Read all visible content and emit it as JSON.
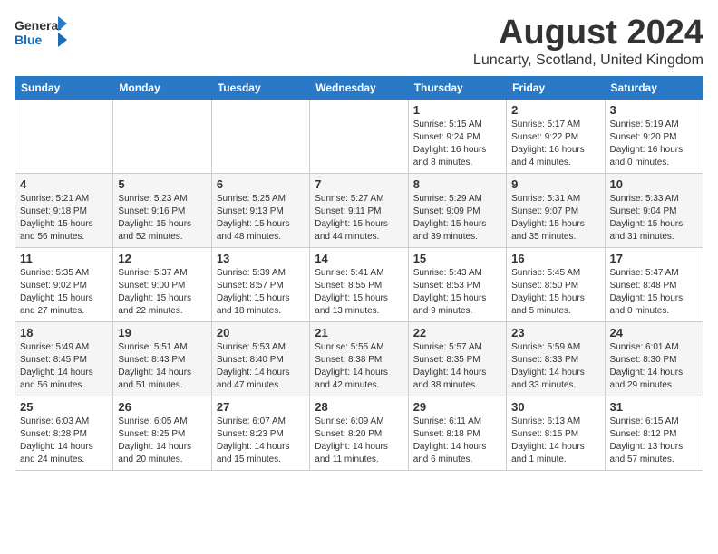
{
  "logo": {
    "general": "General",
    "blue": "Blue"
  },
  "header": {
    "title": "August 2024",
    "subtitle": "Luncarty, Scotland, United Kingdom"
  },
  "weekdays": [
    "Sunday",
    "Monday",
    "Tuesday",
    "Wednesday",
    "Thursday",
    "Friday",
    "Saturday"
  ],
  "weeks": [
    [
      {
        "day": "",
        "info": ""
      },
      {
        "day": "",
        "info": ""
      },
      {
        "day": "",
        "info": ""
      },
      {
        "day": "",
        "info": ""
      },
      {
        "day": "1",
        "info": "Sunrise: 5:15 AM\nSunset: 9:24 PM\nDaylight: 16 hours\nand 8 minutes."
      },
      {
        "day": "2",
        "info": "Sunrise: 5:17 AM\nSunset: 9:22 PM\nDaylight: 16 hours\nand 4 minutes."
      },
      {
        "day": "3",
        "info": "Sunrise: 5:19 AM\nSunset: 9:20 PM\nDaylight: 16 hours\nand 0 minutes."
      }
    ],
    [
      {
        "day": "4",
        "info": "Sunrise: 5:21 AM\nSunset: 9:18 PM\nDaylight: 15 hours\nand 56 minutes."
      },
      {
        "day": "5",
        "info": "Sunrise: 5:23 AM\nSunset: 9:16 PM\nDaylight: 15 hours\nand 52 minutes."
      },
      {
        "day": "6",
        "info": "Sunrise: 5:25 AM\nSunset: 9:13 PM\nDaylight: 15 hours\nand 48 minutes."
      },
      {
        "day": "7",
        "info": "Sunrise: 5:27 AM\nSunset: 9:11 PM\nDaylight: 15 hours\nand 44 minutes."
      },
      {
        "day": "8",
        "info": "Sunrise: 5:29 AM\nSunset: 9:09 PM\nDaylight: 15 hours\nand 39 minutes."
      },
      {
        "day": "9",
        "info": "Sunrise: 5:31 AM\nSunset: 9:07 PM\nDaylight: 15 hours\nand 35 minutes."
      },
      {
        "day": "10",
        "info": "Sunrise: 5:33 AM\nSunset: 9:04 PM\nDaylight: 15 hours\nand 31 minutes."
      }
    ],
    [
      {
        "day": "11",
        "info": "Sunrise: 5:35 AM\nSunset: 9:02 PM\nDaylight: 15 hours\nand 27 minutes."
      },
      {
        "day": "12",
        "info": "Sunrise: 5:37 AM\nSunset: 9:00 PM\nDaylight: 15 hours\nand 22 minutes."
      },
      {
        "day": "13",
        "info": "Sunrise: 5:39 AM\nSunset: 8:57 PM\nDaylight: 15 hours\nand 18 minutes."
      },
      {
        "day": "14",
        "info": "Sunrise: 5:41 AM\nSunset: 8:55 PM\nDaylight: 15 hours\nand 13 minutes."
      },
      {
        "day": "15",
        "info": "Sunrise: 5:43 AM\nSunset: 8:53 PM\nDaylight: 15 hours\nand 9 minutes."
      },
      {
        "day": "16",
        "info": "Sunrise: 5:45 AM\nSunset: 8:50 PM\nDaylight: 15 hours\nand 5 minutes."
      },
      {
        "day": "17",
        "info": "Sunrise: 5:47 AM\nSunset: 8:48 PM\nDaylight: 15 hours\nand 0 minutes."
      }
    ],
    [
      {
        "day": "18",
        "info": "Sunrise: 5:49 AM\nSunset: 8:45 PM\nDaylight: 14 hours\nand 56 minutes."
      },
      {
        "day": "19",
        "info": "Sunrise: 5:51 AM\nSunset: 8:43 PM\nDaylight: 14 hours\nand 51 minutes."
      },
      {
        "day": "20",
        "info": "Sunrise: 5:53 AM\nSunset: 8:40 PM\nDaylight: 14 hours\nand 47 minutes."
      },
      {
        "day": "21",
        "info": "Sunrise: 5:55 AM\nSunset: 8:38 PM\nDaylight: 14 hours\nand 42 minutes."
      },
      {
        "day": "22",
        "info": "Sunrise: 5:57 AM\nSunset: 8:35 PM\nDaylight: 14 hours\nand 38 minutes."
      },
      {
        "day": "23",
        "info": "Sunrise: 5:59 AM\nSunset: 8:33 PM\nDaylight: 14 hours\nand 33 minutes."
      },
      {
        "day": "24",
        "info": "Sunrise: 6:01 AM\nSunset: 8:30 PM\nDaylight: 14 hours\nand 29 minutes."
      }
    ],
    [
      {
        "day": "25",
        "info": "Sunrise: 6:03 AM\nSunset: 8:28 PM\nDaylight: 14 hours\nand 24 minutes."
      },
      {
        "day": "26",
        "info": "Sunrise: 6:05 AM\nSunset: 8:25 PM\nDaylight: 14 hours\nand 20 minutes."
      },
      {
        "day": "27",
        "info": "Sunrise: 6:07 AM\nSunset: 8:23 PM\nDaylight: 14 hours\nand 15 minutes."
      },
      {
        "day": "28",
        "info": "Sunrise: 6:09 AM\nSunset: 8:20 PM\nDaylight: 14 hours\nand 11 minutes."
      },
      {
        "day": "29",
        "info": "Sunrise: 6:11 AM\nSunset: 8:18 PM\nDaylight: 14 hours\nand 6 minutes."
      },
      {
        "day": "30",
        "info": "Sunrise: 6:13 AM\nSunset: 8:15 PM\nDaylight: 14 hours\nand 1 minute."
      },
      {
        "day": "31",
        "info": "Sunrise: 6:15 AM\nSunset: 8:12 PM\nDaylight: 13 hours\nand 57 minutes."
      }
    ]
  ]
}
